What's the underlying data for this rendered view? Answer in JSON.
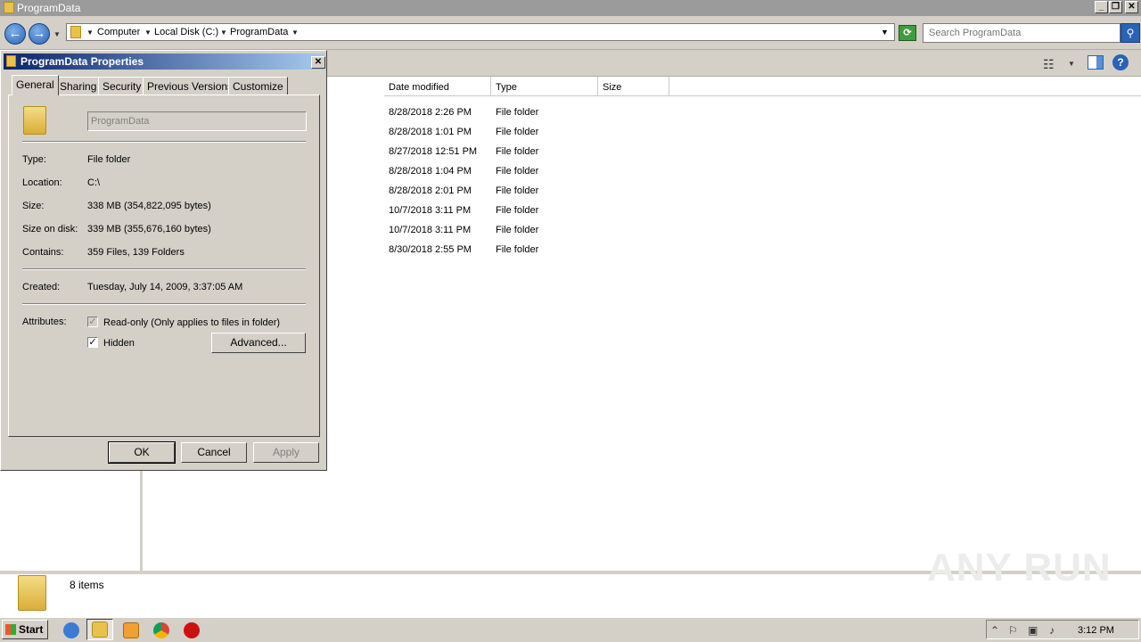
{
  "window": {
    "title": "ProgramData"
  },
  "address": {
    "crumbs": [
      "Computer",
      "Local Disk (C:)",
      "ProgramData"
    ]
  },
  "search": {
    "placeholder": "Search ProgramData"
  },
  "columns": [
    "Date modified",
    "Type",
    "Size"
  ],
  "files": [
    {
      "date": "8/28/2018 2:26 PM",
      "type": "File folder"
    },
    {
      "date": "8/28/2018 1:01 PM",
      "type": "File folder"
    },
    {
      "date": "8/27/2018 12:51 PM",
      "type": "File folder"
    },
    {
      "date": "8/28/2018 1:04 PM",
      "type": "File folder"
    },
    {
      "date": "8/28/2018 2:01 PM",
      "type": "File folder"
    },
    {
      "date": "10/7/2018 3:11 PM",
      "type": "File folder"
    },
    {
      "date": "10/7/2018 3:11 PM",
      "type": "File folder"
    },
    {
      "date": "8/30/2018 2:55 PM",
      "type": "File folder"
    }
  ],
  "details": {
    "count": "8 items"
  },
  "watermark": "ANY RUN",
  "dialog": {
    "title": "ProgramData Properties",
    "tabs": [
      "General",
      "Sharing",
      "Security",
      "Previous Versions",
      "Customize"
    ],
    "name_value": "ProgramData",
    "labels": {
      "type": "Type:",
      "location": "Location:",
      "size": "Size:",
      "size_on_disk": "Size on disk:",
      "contains": "Contains:",
      "created": "Created:",
      "attributes": "Attributes:"
    },
    "values": {
      "type": "File folder",
      "location": "C:\\",
      "size": "338 MB (354,822,095 bytes)",
      "size_on_disk": "339 MB (355,676,160 bytes)",
      "contains": "359 Files, 139 Folders",
      "created": "Tuesday, July 14, 2009, 3:37:05 AM"
    },
    "attributes": {
      "readonly_label": "Read-only (Only applies to files in folder)",
      "hidden_label": "Hidden",
      "advanced_button": "Advanced..."
    },
    "buttons": {
      "ok": "OK",
      "cancel": "Cancel",
      "apply": "Apply"
    }
  },
  "taskbar": {
    "start_label": "Start",
    "clock": "3:12 PM"
  }
}
